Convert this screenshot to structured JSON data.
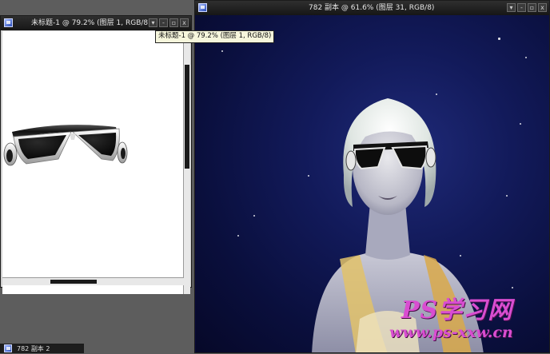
{
  "left_window": {
    "title": "未标题-1 @ 79.2% (图层 1, RGB/8)",
    "tooltip": "未标题-1 @ 79.2% (图层 1, RGB/8)",
    "buttons": [
      "▾",
      "-",
      "▫",
      "x"
    ]
  },
  "right_window": {
    "title": "782 副本 @ 61.6% (图层 31, RGB/8)",
    "buttons": [
      "▾",
      "-",
      "▫",
      "x"
    ]
  },
  "bottom_window": {
    "title": "782 副本 2"
  },
  "watermark": {
    "line1": "PS学习网",
    "line2": "www.ps-xxw.cn"
  }
}
